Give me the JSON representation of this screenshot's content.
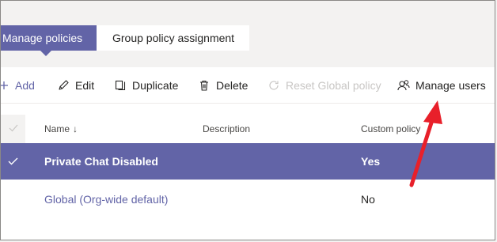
{
  "tabs": [
    {
      "label": "Manage policies",
      "active": true
    },
    {
      "label": "Group policy assignment",
      "active": false
    }
  ],
  "toolbar": {
    "add": {
      "label": "Add",
      "icon": "plus-icon"
    },
    "edit": {
      "label": "Edit",
      "icon": "pencil-icon"
    },
    "duplicate": {
      "label": "Duplicate",
      "icon": "copy-icon"
    },
    "delete": {
      "label": "Delete",
      "icon": "trash-icon"
    },
    "reset": {
      "label": "Reset Global policy",
      "icon": "refresh-icon",
      "disabled": true
    },
    "manage": {
      "label": "Manage users",
      "icon": "users-icon"
    }
  },
  "table": {
    "columns": {
      "name": "Name",
      "sort_indicator": "↓",
      "description": "Description",
      "custom": "Custom policy"
    },
    "rows": [
      {
        "name": "Private Chat Disabled",
        "description": "",
        "custom": "Yes",
        "selected": true
      },
      {
        "name": "Global (Org-wide default)",
        "description": "",
        "custom": "No",
        "selected": false
      }
    ]
  },
  "colors": {
    "accent": "#6264a7",
    "annotation_arrow": "#e8202a"
  }
}
